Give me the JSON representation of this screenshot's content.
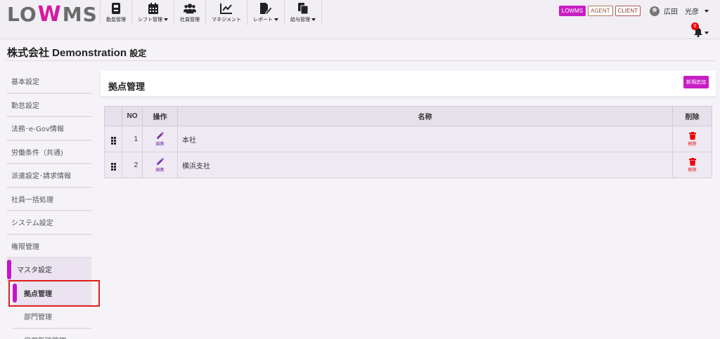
{
  "brand": {
    "logo_left": "LO",
    "logo_w": "W",
    "logo_right": "MS"
  },
  "nav": [
    {
      "label": "勤怠管理",
      "icon": "timecard-icon",
      "dropdown": false
    },
    {
      "label": "シフト管理",
      "icon": "calendar-icon",
      "dropdown": true
    },
    {
      "label": "社員管理",
      "icon": "users-icon",
      "dropdown": false
    },
    {
      "label": "マネジメント",
      "icon": "line-chart-icon",
      "dropdown": false
    },
    {
      "label": "レポート",
      "icon": "report-edit-icon",
      "dropdown": true
    },
    {
      "label": "給与管理",
      "icon": "documents-icon",
      "dropdown": true
    }
  ],
  "header": {
    "badges": [
      "LOWMS",
      "AGENT",
      "CLIENT"
    ],
    "user_name": "広田　光彦",
    "notification_count": "0"
  },
  "page": {
    "title": "株式会社 Demonstration",
    "title_suffix": "設定"
  },
  "sidebar": {
    "items": [
      {
        "label": "基本設定"
      },
      {
        "label": "勤怠設定"
      },
      {
        "label": "法務･e-Gov情報"
      },
      {
        "label": "労働条件（共通)"
      },
      {
        "label": "派遣設定･請求情報"
      },
      {
        "label": "社員一括処理"
      },
      {
        "label": "システム設定"
      },
      {
        "label": "権限管理"
      },
      {
        "label": "マスタ設定"
      }
    ],
    "sub_items": [
      {
        "label": "拠点管理"
      },
      {
        "label": "部門管理"
      },
      {
        "label": "雇用形態管理"
      }
    ]
  },
  "main": {
    "title": "拠点管理",
    "add_button": "新規追加",
    "table": {
      "headers": {
        "no": "NO",
        "op": "操作",
        "name": "名称",
        "del": "削除"
      },
      "edit_label": "編集",
      "delete_label": "削除",
      "rows": [
        {
          "no": "1",
          "name": "本社"
        },
        {
          "no": "2",
          "name": "横浜支社"
        }
      ]
    }
  },
  "colors": {
    "accent": "#c71ec4",
    "delete": "#e00000",
    "edit": "#7a2fa8"
  }
}
